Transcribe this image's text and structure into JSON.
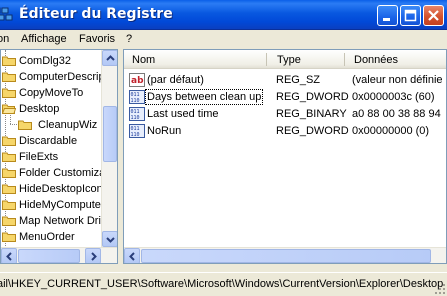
{
  "window": {
    "title": "Éditeur du Registre",
    "title_bar_color": "#0a5fe8"
  },
  "menu": {
    "items": [
      "on",
      "Affichage",
      "Favoris",
      "?"
    ]
  },
  "tree": {
    "items": [
      {
        "label": "ComDlg32",
        "icon": "folder-icon"
      },
      {
        "label": "ComputerDescrip",
        "icon": "folder-icon"
      },
      {
        "label": "CopyMoveTo",
        "icon": "folder-icon"
      },
      {
        "label": "Desktop",
        "icon": "folder-open-icon"
      },
      {
        "label": "CleanupWiz",
        "icon": "folder-icon",
        "child": true
      },
      {
        "label": "Discardable",
        "icon": "folder-icon"
      },
      {
        "label": "FileExts",
        "icon": "folder-icon"
      },
      {
        "label": "Folder Customiza",
        "icon": "folder-icon"
      },
      {
        "label": "HideDesktopIcon",
        "icon": "folder-icon"
      },
      {
        "label": "HideMyComputer",
        "icon": "folder-icon"
      },
      {
        "label": "Map Network Driv",
        "icon": "folder-icon"
      },
      {
        "label": "MenuOrder",
        "icon": "folder-icon"
      }
    ]
  },
  "list": {
    "columns": [
      "Nom",
      "Type",
      "Données"
    ],
    "rows": [
      {
        "name": "(par défaut)",
        "type": "REG_SZ",
        "data": "(valeur non définie",
        "icon": "string-value-icon"
      },
      {
        "name": "Days between clean up",
        "type": "REG_DWORD",
        "data": "0x0000003c (60)",
        "icon": "binary-value-icon",
        "selected": true
      },
      {
        "name": "Last used time",
        "type": "REG_BINARY",
        "data": "a0 88 00 38 88 94",
        "icon": "binary-value-icon"
      },
      {
        "name": "NoRun",
        "type": "REG_DWORD",
        "data": "0x00000000 (0)",
        "icon": "binary-value-icon"
      }
    ]
  },
  "status": {
    "path": "ail\\HKEY_CURRENT_USER\\Software\\Microsoft\\Windows\\CurrentVersion\\Explorer\\Desktop"
  }
}
